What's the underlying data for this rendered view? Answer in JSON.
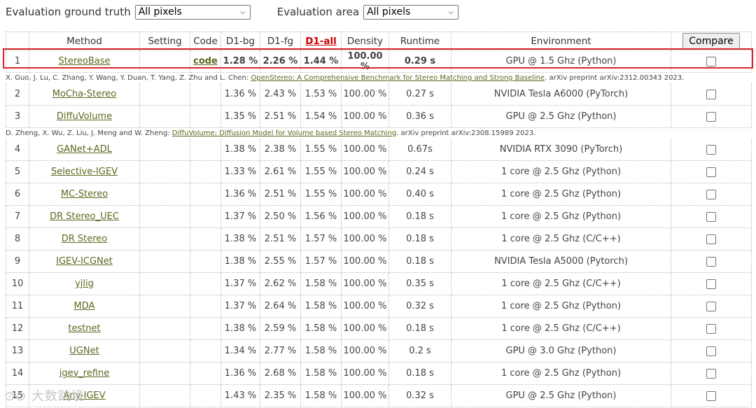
{
  "filters": {
    "truth_label": "Evaluation ground truth",
    "truth_value": "All pixels",
    "area_label": "Evaluation area",
    "area_value": "All pixels"
  },
  "table": {
    "headers": [
      "",
      "Method",
      "Setting",
      "Code",
      "D1-bg",
      "D1-fg",
      "D1-all",
      "Density",
      "Runtime",
      "Environment"
    ],
    "compare_label": "Compare",
    "rows": [
      {
        "idx": "1",
        "method": "StereoBase",
        "code": "code",
        "bg": "1.28 %",
        "fg": "2.26 %",
        "all": "1.44 %",
        "density": "100.00 %",
        "runtime": "0.29 s",
        "env": "GPU @ 1.5 Ghz (Python)",
        "cite_pre": "X. Guo, J. Lu, C. Zhang, Y. Wang, Y. Duan, T. Yang, Z. Zhu and L. Chen: ",
        "cite_link": "OpenStereo: A Comprehensive Benchmark for Stereo Matching and Strong Baseline",
        "cite_post": ". arXiv preprint arXiv:2312.00343 2023."
      },
      {
        "idx": "2",
        "method": "MoCha-Stereo",
        "code": "",
        "bg": "1.36 %",
        "fg": "2.43 %",
        "all": "1.53 %",
        "density": "100.00 %",
        "runtime": "0.27 s",
        "env": "NVIDIA Tesla A6000 (PyTorch)"
      },
      {
        "idx": "3",
        "method": "DiffuVolume",
        "code": "",
        "bg": "1.35 %",
        "fg": "2.51 %",
        "all": "1.54 %",
        "density": "100.00 %",
        "runtime": "0.36 s",
        "env": "GPU @ 2.5 Ghz (Python)",
        "cite_pre": "D. Zheng, X. Wu, Z. Liu, J. Meng and W. Zheng: ",
        "cite_link": "DiffuVolume: Diffusion Model for Volume based Stereo Matching",
        "cite_post": ". arXiv preprint arXiv:2308.15989 2023."
      },
      {
        "idx": "4",
        "method": "GANet+ADL",
        "code": "",
        "bg": "1.38 %",
        "fg": "2.38 %",
        "all": "1.55 %",
        "density": "100.00 %",
        "runtime": "0.67s",
        "env": "NVIDIA RTX 3090 (PyTorch)"
      },
      {
        "idx": "5",
        "method": "Selective-IGEV",
        "code": "",
        "bg": "1.33 %",
        "fg": "2.61 %",
        "all": "1.55 %",
        "density": "100.00 %",
        "runtime": "0.24 s",
        "env": "1 core @ 2.5 Ghz (Python)"
      },
      {
        "idx": "6",
        "method": "MC-Stereo",
        "code": "",
        "bg": "1.36 %",
        "fg": "2.51 %",
        "all": "1.55 %",
        "density": "100.00 %",
        "runtime": "0.40 s",
        "env": "1 core @ 2.5 Ghz (Python)"
      },
      {
        "idx": "7",
        "method": "DR Stereo_UEC",
        "code": "",
        "bg": "1.37 %",
        "fg": "2.50 %",
        "all": "1.56 %",
        "density": "100.00 %",
        "runtime": "0.18 s",
        "env": "1 core @ 2.5 Ghz (Python)"
      },
      {
        "idx": "8",
        "method": "DR Stereo",
        "code": "",
        "bg": "1.38 %",
        "fg": "2.51 %",
        "all": "1.57 %",
        "density": "100.00 %",
        "runtime": "0.18 s",
        "env": "1 core @ 2.5 Ghz (C/C++)"
      },
      {
        "idx": "9",
        "method": "IGEV-ICGNet",
        "code": "",
        "bg": "1.38 %",
        "fg": "2.55 %",
        "all": "1.57 %",
        "density": "100.00 %",
        "runtime": "0.18 s",
        "env": "NVIDIA Tesla A5000 (Pytorch)"
      },
      {
        "idx": "10",
        "method": "yjlig",
        "code": "",
        "bg": "1.37 %",
        "fg": "2.62 %",
        "all": "1.58 %",
        "density": "100.00 %",
        "runtime": "0.35 s",
        "env": "1 core @ 2.5 Ghz (C/C++)"
      },
      {
        "idx": "11",
        "method": "MDA",
        "code": "",
        "bg": "1.37 %",
        "fg": "2.64 %",
        "all": "1.58 %",
        "density": "100.00 %",
        "runtime": "0.32 s",
        "env": "1 core @ 2.5 Ghz (Python)"
      },
      {
        "idx": "12",
        "method": "testnet",
        "code": "",
        "bg": "1.38 %",
        "fg": "2.59 %",
        "all": "1.58 %",
        "density": "100.00 %",
        "runtime": "0.18 s",
        "env": "1 core @ 2.5 Ghz (C/C++)"
      },
      {
        "idx": "13",
        "method": "UGNet",
        "code": "",
        "bg": "1.34 %",
        "fg": "2.77 %",
        "all": "1.58 %",
        "density": "100.00 %",
        "runtime": "0.2 s",
        "env": "GPU @ 3.0 Ghz (Python)"
      },
      {
        "idx": "14",
        "method": "igev_refine",
        "code": "",
        "bg": "1.36 %",
        "fg": "2.68 %",
        "all": "1.58 %",
        "density": "100.00 %",
        "runtime": "0.18 s",
        "env": "1 core @ 2.5 Ghz (Python)"
      },
      {
        "idx": "15",
        "method": "Any-IGEV",
        "code": "",
        "bg": "1.43 %",
        "fg": "2.35 %",
        "all": "1.58 %",
        "density": "100.00 %",
        "runtime": "0.32 s",
        "env": "GPU @ 2.5 Ghz (Python)"
      }
    ]
  },
  "watermark": "⊙⊙ 大数践境",
  "colors": {
    "link": "#5a6a1f",
    "d1all": "#cc0000",
    "highlight": "#d9262b"
  }
}
